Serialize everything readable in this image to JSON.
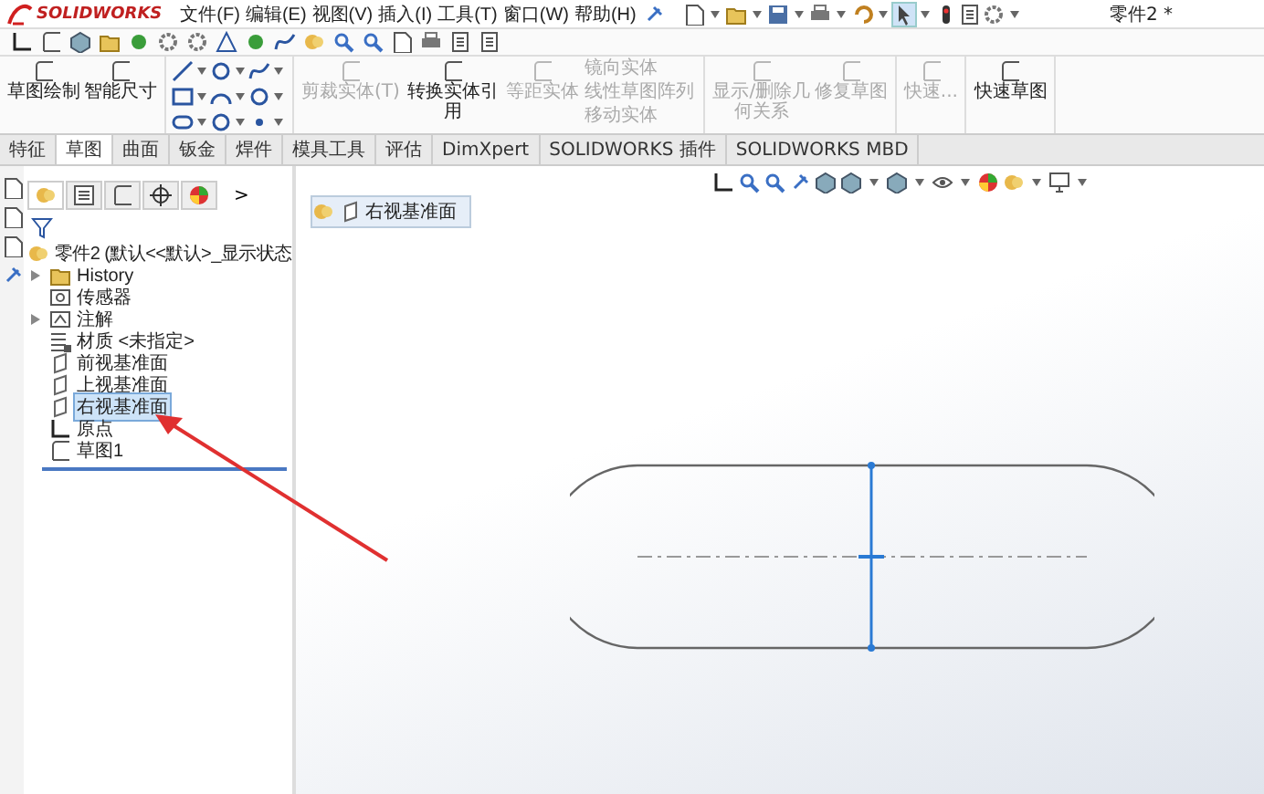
{
  "logo": {
    "text": "SOLIDWORKS"
  },
  "menu": [
    {
      "label": "文件(F)"
    },
    {
      "label": "编辑(E)"
    },
    {
      "label": "视图(V)"
    },
    {
      "label": "插入(I)"
    },
    {
      "label": "工具(T)"
    },
    {
      "label": "窗口(W)"
    },
    {
      "label": "帮助(H)"
    }
  ],
  "document_title": "零件2 *",
  "command_groups": [
    {
      "items": [
        {
          "kind": "large",
          "label": "草图绘制",
          "disabled": false
        },
        {
          "kind": "large",
          "label": "智能尺寸",
          "disabled": false
        }
      ]
    },
    {
      "items": [
        {
          "kind": "tools"
        }
      ]
    },
    {
      "items": [
        {
          "kind": "large",
          "label": "剪裁实体(T)",
          "disabled": true
        },
        {
          "kind": "large",
          "label": "转换实体引用",
          "disabled": false
        },
        {
          "kind": "large",
          "label": "等距实体",
          "disabled": true
        },
        {
          "kind": "stack",
          "entries": [
            {
              "label": "镜向实体",
              "disabled": true
            },
            {
              "label": "线性草图阵列",
              "disabled": true
            },
            {
              "label": "移动实体",
              "disabled": true
            }
          ]
        }
      ]
    },
    {
      "items": [
        {
          "kind": "large",
          "label": "显示/删除几何关系",
          "disabled": true
        },
        {
          "kind": "large",
          "label": "修复草图",
          "disabled": true
        }
      ]
    },
    {
      "items": [
        {
          "kind": "large",
          "label": "快速...",
          "disabled": true
        }
      ]
    },
    {
      "items": [
        {
          "kind": "large",
          "label": "快速草图",
          "disabled": false
        }
      ]
    }
  ],
  "tabs": [
    {
      "label": "特征",
      "selected": false
    },
    {
      "label": "草图",
      "selected": true
    },
    {
      "label": "曲面",
      "selected": false
    },
    {
      "label": "钣金",
      "selected": false
    },
    {
      "label": "焊件",
      "selected": false
    },
    {
      "label": "模具工具",
      "selected": false
    },
    {
      "label": "评估",
      "selected": false
    },
    {
      "label": "DimXpert",
      "selected": false
    },
    {
      "label": "SOLIDWORKS 插件",
      "selected": false
    },
    {
      "label": "SOLIDWORKS MBD",
      "selected": false
    }
  ],
  "panel_tabs": [
    {
      "selected": true
    },
    {
      "selected": false
    },
    {
      "selected": false
    },
    {
      "selected": false
    },
    {
      "selected": false
    }
  ],
  "panel_more": ">",
  "feature_tree": {
    "label": "零件2 (默认<<默认>_显示状态",
    "children": [
      {
        "kind": "folder",
        "label": "History",
        "expandable": true,
        "selected": false
      },
      {
        "kind": "sensor",
        "label": "传感器",
        "expandable": false,
        "selected": false
      },
      {
        "kind": "annotation",
        "label": "注解",
        "expandable": true,
        "selected": false
      },
      {
        "kind": "material",
        "label": "材质 <未指定>",
        "expandable": false,
        "selected": false
      },
      {
        "kind": "plane",
        "label": "前视基准面",
        "expandable": false,
        "selected": false
      },
      {
        "kind": "plane",
        "label": "上视基准面",
        "expandable": false,
        "selected": false
      },
      {
        "kind": "plane",
        "label": "右视基准面",
        "expandable": false,
        "selected": true
      },
      {
        "kind": "origin",
        "label": "原点",
        "expandable": false,
        "selected": false
      },
      {
        "kind": "sketch",
        "label": "草图1",
        "expandable": false,
        "selected": false
      }
    ]
  },
  "breadcrumb": {
    "label": "右视基准面"
  }
}
